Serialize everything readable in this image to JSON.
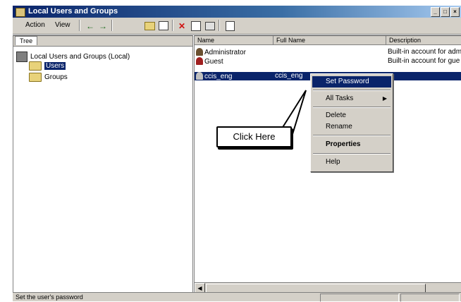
{
  "window": {
    "title": "Local Users and Groups",
    "controls": [
      "_",
      "□",
      "×"
    ]
  },
  "toolbar": {
    "menus": [
      "Action",
      "View"
    ]
  },
  "left_pane": {
    "tab": "Tree",
    "root": "Local Users and Groups (Local)",
    "children": [
      "Users",
      "Groups"
    ]
  },
  "right_pane": {
    "columns": [
      "Name",
      "Full Name",
      "Description"
    ],
    "rows": [
      {
        "name": "Administrator",
        "full_name": "",
        "description": "Built-in account for adm"
      },
      {
        "name": "Guest",
        "full_name": "",
        "description": "Built-in account for gue"
      },
      {
        "name": "ccis_eng",
        "full_name": "ccis_eng",
        "description": ""
      }
    ]
  },
  "context_menu": {
    "items": [
      "Set Password",
      "All Tasks",
      "Delete",
      "Rename",
      "Properties",
      "Help"
    ]
  },
  "callout": {
    "text": "Click Here"
  },
  "status_bar": {
    "text": "Set the user's password"
  },
  "colors": {
    "selection": "#0a246a",
    "chrome": "#d4d0c8"
  }
}
